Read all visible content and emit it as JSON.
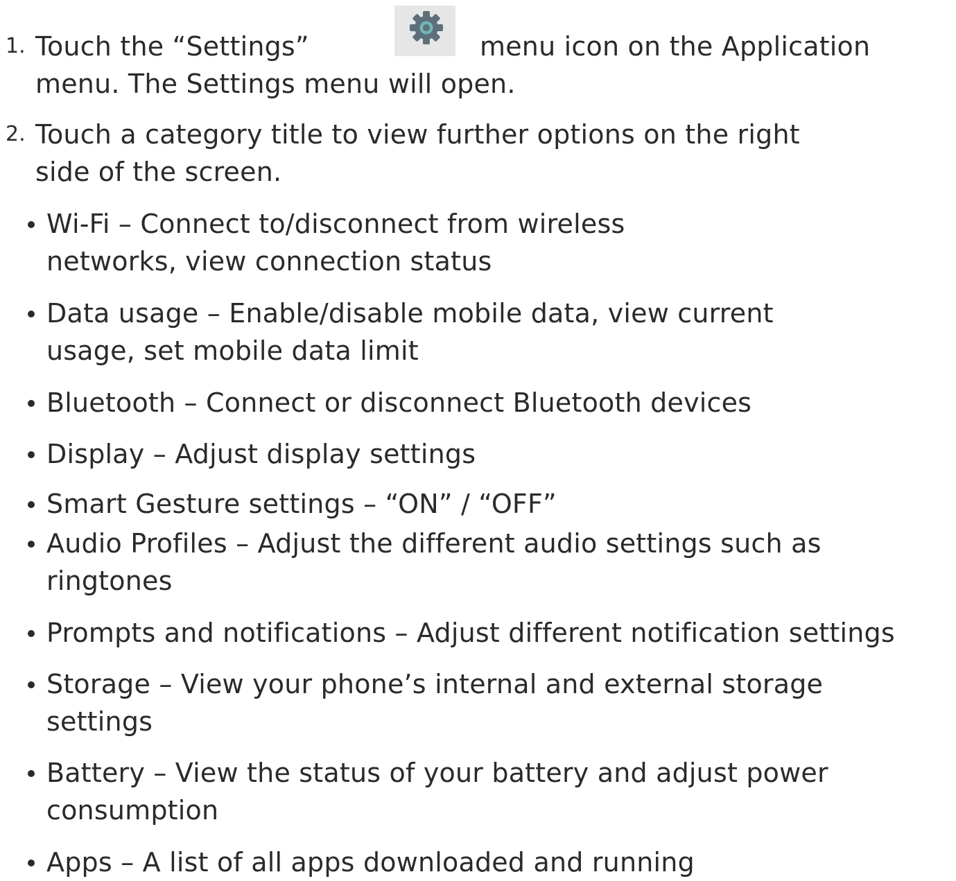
{
  "steps": [
    {
      "number": "1.",
      "line1_before_icon": "Touch the “Settings”",
      "icon": "gear-icon",
      "line1_after_icon": "menu icon on the Application",
      "line2": "menu. The Settings menu will open."
    },
    {
      "number": "2.",
      "line1": "Touch a category title to view further options on the right",
      "line2": "side of the screen."
    }
  ],
  "categories": [
    {
      "lines": [
        "Wi-Fi – Connect to/disconnect from wireless",
        " networks, view connection status"
      ]
    },
    {
      "lines": [
        "Data usage – Enable/disable mobile data, view current",
        "usage, set mobile data limit"
      ]
    },
    {
      "lines": [
        "Bluetooth – Connect or disconnect Bluetooth devices"
      ]
    },
    {
      "lines": [
        "Display – Adjust display settings"
      ]
    },
    {
      "lines": [
        "Smart Gesture settings – “ON” / “OFF”"
      ]
    },
    {
      "lines": [
        "Audio Profiles – Adjust the different audio settings such as",
        "ringtones"
      ]
    },
    {
      "lines": [
        "Prompts and notifications – Adjust different notification settings"
      ]
    },
    {
      "lines": [
        "Storage – View your phone’s internal and external storage",
        "settings"
      ]
    },
    {
      "lines": [
        "Battery – View the status of your battery and adjust power",
        "consumption"
      ]
    },
    {
      "lines": [
        "Apps – A list of all apps downloaded and running"
      ]
    }
  ],
  "colors": {
    "text": "#2a2a2a",
    "icon_bg": "#e6e6e6",
    "gear": "#5d6f7b",
    "gear_center": "#6fb6b6"
  }
}
